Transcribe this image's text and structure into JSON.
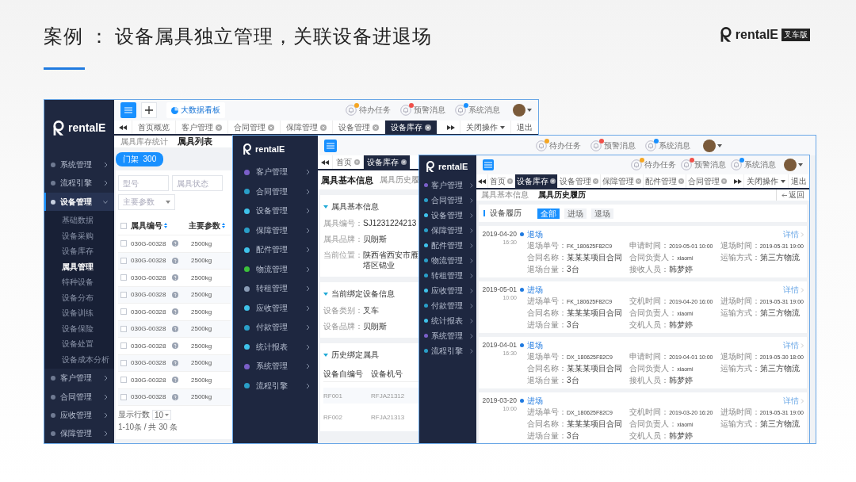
{
  "slide": {
    "title": "案例 ： 设备属具独立管理，关联设备进退场",
    "logo": {
      "name": "rentalE",
      "badge": "叉车版"
    }
  },
  "window_list": {
    "logo": "rentalE",
    "sidebar": {
      "items": [
        {
          "label": "系统管理",
          "selected": false,
          "expanded": false
        },
        {
          "label": "流程引擎",
          "selected": false,
          "expanded": false
        },
        {
          "label": "设备管理",
          "selected": true,
          "expanded": true,
          "children": [
            {
              "label": "基础数据",
              "selected": false
            },
            {
              "label": "设备采购",
              "selected": false
            },
            {
              "label": "设备库存",
              "selected": false
            },
            {
              "label": "属具管理",
              "selected": true
            },
            {
              "label": "特种设备",
              "selected": false
            },
            {
              "label": "设备分布",
              "selected": false
            },
            {
              "label": "设备训练",
              "selected": false
            },
            {
              "label": "设备保险",
              "selected": false
            },
            {
              "label": "设备处置",
              "selected": false
            },
            {
              "label": "设备成本分析",
              "selected": false
            }
          ]
        },
        {
          "label": "客户管理",
          "selected": false,
          "expanded": false
        },
        {
          "label": "合同管理",
          "selected": false,
          "expanded": false
        },
        {
          "label": "应收管理",
          "selected": false,
          "expanded": false
        },
        {
          "label": "保障管理",
          "selected": false,
          "expanded": false
        }
      ]
    },
    "header": {
      "dashboard": "大数据看板",
      "notices": [
        {
          "label": "待办任务",
          "color": "#f5a623"
        },
        {
          "label": "预警消息",
          "color": "#f0504a"
        },
        {
          "label": "系统消息",
          "color": "#1890ff"
        }
      ]
    },
    "tabs": [
      {
        "label": "首页概览",
        "closable": false,
        "selected": false
      },
      {
        "label": "客户管理",
        "closable": true,
        "selected": false
      },
      {
        "label": "合同管理",
        "closable": true,
        "selected": false
      },
      {
        "label": "保障管理",
        "closable": true,
        "selected": false
      },
      {
        "label": "设备管理",
        "closable": true,
        "selected": false
      },
      {
        "label": "设备库存",
        "closable": true,
        "selected": true
      }
    ],
    "tab_actions": {
      "close_menu": "关闭操作",
      "exit": "退出"
    },
    "subtabs": [
      {
        "label": "属具库存统计",
        "selected": false
      },
      {
        "label": "属具列表",
        "selected": true
      }
    ],
    "chip": {
      "label": "门架",
      "count": "300"
    },
    "filters": [
      {
        "kind": "input",
        "placeholder": "型号"
      },
      {
        "kind": "input",
        "placeholder": "属具状态"
      },
      {
        "kind": "select",
        "placeholder": "主要参数"
      }
    ],
    "table": {
      "all_checked": false,
      "columns": [
        "属具编号",
        "主要参数"
      ],
      "rows": [
        {
          "checked": false,
          "cells": [
            "030G-00328",
            "2500kg"
          ]
        },
        {
          "checked": false,
          "cells": [
            "030G-00328",
            "2500kg"
          ]
        },
        {
          "checked": false,
          "cells": [
            "030G-00328",
            "2500kg"
          ]
        },
        {
          "checked": false,
          "cells": [
            "030G-00328",
            "2500kg"
          ]
        },
        {
          "checked": false,
          "cells": [
            "030G-00328",
            "2500kg"
          ]
        },
        {
          "checked": false,
          "cells": [
            "030G-00328",
            "2500kg"
          ]
        },
        {
          "checked": false,
          "cells": [
            "030G-00328",
            "2500kg"
          ]
        },
        {
          "checked": false,
          "cells": [
            "030G-00328",
            "2500kg"
          ]
        },
        {
          "checked": false,
          "cells": [
            "030G-00328",
            "2500kg"
          ]
        },
        {
          "checked": false,
          "cells": [
            "030G-00328",
            "2500kg"
          ]
        }
      ]
    },
    "pagination": {
      "label": "显示行数",
      "page_size": "10",
      "range": "1-10条 / 共 30 条"
    }
  },
  "window_detail": {
    "logo": "rentalE",
    "sidebar": {
      "items": [
        {
          "label": "客户管理",
          "color": "#7b5fc9"
        },
        {
          "label": "合同管理",
          "color": "#2a9fc8"
        },
        {
          "label": "设备管理",
          "color": "#3fc2ea"
        },
        {
          "label": "保障管理",
          "color": "#2a9fc8"
        },
        {
          "label": "配件管理",
          "color": "#3fc2ea"
        },
        {
          "label": "物流管理",
          "color": "#3cc13b"
        },
        {
          "label": "转租管理",
          "color": "#8a9bb5"
        },
        {
          "label": "应收管理",
          "color": "#3fc2ea"
        },
        {
          "label": "付款管理",
          "color": "#2a9fc8"
        },
        {
          "label": "统计报表",
          "color": "#3fc2ea"
        },
        {
          "label": "系统管理",
          "color": "#7b5fc9"
        },
        {
          "label": "流程引擎",
          "color": "#2a9fc8"
        }
      ]
    },
    "header": {
      "notices": [
        {
          "label": "待办任务",
          "color": "#f5a623"
        },
        {
          "label": "预警消息",
          "color": "#f0504a"
        },
        {
          "label": "系统消息",
          "color": "#1890ff"
        }
      ]
    },
    "tabs": [
      {
        "label": "首页",
        "closable": true,
        "selected": false
      },
      {
        "label": "设备库存",
        "closable": true,
        "selected": true
      }
    ],
    "subtabs": [
      {
        "label": "属具基本信息",
        "selected": true
      },
      {
        "label": "属具历史履",
        "selected": false
      }
    ],
    "sections": [
      {
        "kind": "fields",
        "title": "属具基本信息",
        "fields": [
          {
            "label": "属具编号：",
            "value": "SJ1231224213"
          },
          {
            "label": "属具品牌：",
            "value": "贝朗斯"
          },
          {
            "label": "当前位置：",
            "value": "陕西省西安市雁塔区锦业"
          }
        ]
      },
      {
        "kind": "fields",
        "title": "当前绑定设备信息",
        "fields": [
          {
            "label": "设备类别：",
            "value": "叉车"
          },
          {
            "label": "设备品牌：",
            "value": "贝朗斯"
          }
        ]
      },
      {
        "kind": "table",
        "title": "历史绑定属具",
        "columns": [
          "设备自编号",
          "设备机号"
        ],
        "rows": [
          [
            "RF001",
            "RFJA21312"
          ],
          [
            "RF002",
            "RFJA21313"
          ]
        ]
      }
    ]
  },
  "window_history": {
    "logo": "rentalE",
    "sidebar": {
      "items": [
        {
          "label": "客户管理",
          "color": "#7b5fc9"
        },
        {
          "label": "合同管理",
          "color": "#2a9fc8"
        },
        {
          "label": "设备管理",
          "color": "#3fc2ea"
        },
        {
          "label": "保障管理",
          "color": "#2a9fc8"
        },
        {
          "label": "配件管理",
          "color": "#3fc2ea"
        },
        {
          "label": "物流管理",
          "color": "#2a9fc8"
        },
        {
          "label": "转租管理",
          "color": "#2a9fc8"
        },
        {
          "label": "应收管理",
          "color": "#3fc2ea"
        },
        {
          "label": "付款管理",
          "color": "#2a9fc8"
        },
        {
          "label": "统计报表",
          "color": "#3fc2ea"
        },
        {
          "label": "系统管理",
          "color": "#7b5fc9"
        },
        {
          "label": "流程引擎",
          "color": "#2a9fc8"
        }
      ]
    },
    "header": {
      "notices": [
        {
          "label": "待办任务",
          "color": "#f5a623"
        },
        {
          "label": "预警消息",
          "color": "#f0504a"
        },
        {
          "label": "系统消息",
          "color": "#1890ff"
        }
      ]
    },
    "tabs": [
      {
        "label": "首页",
        "closable": true,
        "selected": false
      },
      {
        "label": "设备库存",
        "closable": true,
        "selected": true
      },
      {
        "label": "设备管理",
        "closable": true,
        "selected": false
      },
      {
        "label": "保障管理",
        "closable": true,
        "selected": false
      },
      {
        "label": "配件管理",
        "closable": true,
        "selected": false
      },
      {
        "label": "合同管理",
        "closable": true,
        "selected": false
      }
    ],
    "tab_actions": {
      "close_menu": "关闭操作",
      "exit": "退出"
    },
    "subtabs": [
      {
        "label": "属具基本信息",
        "selected": false
      },
      {
        "label": "属具历史履历",
        "selected": true
      }
    ],
    "back": "返回",
    "history_filter": {
      "title": "设备履历",
      "options": [
        {
          "label": "全部",
          "selected": true
        },
        {
          "label": "进场",
          "selected": false
        },
        {
          "label": "退场",
          "selected": false
        }
      ]
    },
    "records": [
      {
        "date": "2019-04-20",
        "time": "16:30",
        "type": "退场",
        "detail": "详情",
        "fields": [
          {
            "label": "退场单号：",
            "value": "FK_180625F82C9"
          },
          {
            "label": "申请时间：",
            "value": "2019-05-01 10:00"
          },
          {
            "label": "退场时间：",
            "value": "2019-05-31 19:00"
          },
          {
            "label": "合同名称：",
            "value": "某某某项目合同"
          },
          {
            "label": "合同负责人：",
            "value": "xiaomi"
          },
          {
            "label": "运输方式：",
            "value": "第三方物流"
          },
          {
            "label": "退场台量：",
            "value": "3台"
          },
          {
            "label": "接收人员：",
            "value": "韩梦婷"
          }
        ]
      },
      {
        "date": "2019-05-01",
        "time": "10:00",
        "type": "进场",
        "detail": "详情",
        "fields": [
          {
            "label": "进场单号：",
            "value": "FK_180625F82C9"
          },
          {
            "label": "交机时间：",
            "value": "2019-04-20 16:00"
          },
          {
            "label": "进场时间：",
            "value": "2019-05-31 19:00"
          },
          {
            "label": "合同名称：",
            "value": "某某某项目合同"
          },
          {
            "label": "合同负责人：",
            "value": "xiaomi"
          },
          {
            "label": "运输方式：",
            "value": "第三方物流"
          },
          {
            "label": "进场台量：",
            "value": "3台"
          },
          {
            "label": "交机人员：",
            "value": "韩梦婷"
          }
        ]
      },
      {
        "date": "2019-04-01",
        "time": "16:30",
        "type": "退场",
        "detail": "详情",
        "fields": [
          {
            "label": "退场单号：",
            "value": "DX_180625F82C9"
          },
          {
            "label": "申请时间：",
            "value": "2019-04-01 10:00"
          },
          {
            "label": "退场时间：",
            "value": "2019-05-30 18:00"
          },
          {
            "label": "合同名称：",
            "value": "某某某项目合同"
          },
          {
            "label": "合同负责人：",
            "value": "xiaomi"
          },
          {
            "label": "运输方式：",
            "value": "第三方物流"
          },
          {
            "label": "退场台量：",
            "value": "3台"
          },
          {
            "label": "接机人员：",
            "value": "韩梦婷"
          }
        ]
      },
      {
        "date": "2019-03-20",
        "time": "10:00",
        "type": "进场",
        "detail": "详情",
        "fields": [
          {
            "label": "进场单号：",
            "value": "DX_180625F82C9"
          },
          {
            "label": "交机时间：",
            "value": "2019-03-20 16:20"
          },
          {
            "label": "进场时间：",
            "value": "2019-05-31 19:00"
          },
          {
            "label": "合同名称：",
            "value": "某某某项目合同"
          },
          {
            "label": "合同负责人：",
            "value": "xiaomi"
          },
          {
            "label": "运输方式：",
            "value": "第三方物流"
          },
          {
            "label": "进场台量：",
            "value": "3台"
          },
          {
            "label": "交机人员：",
            "value": "韩梦婷"
          }
        ]
      }
    ]
  }
}
